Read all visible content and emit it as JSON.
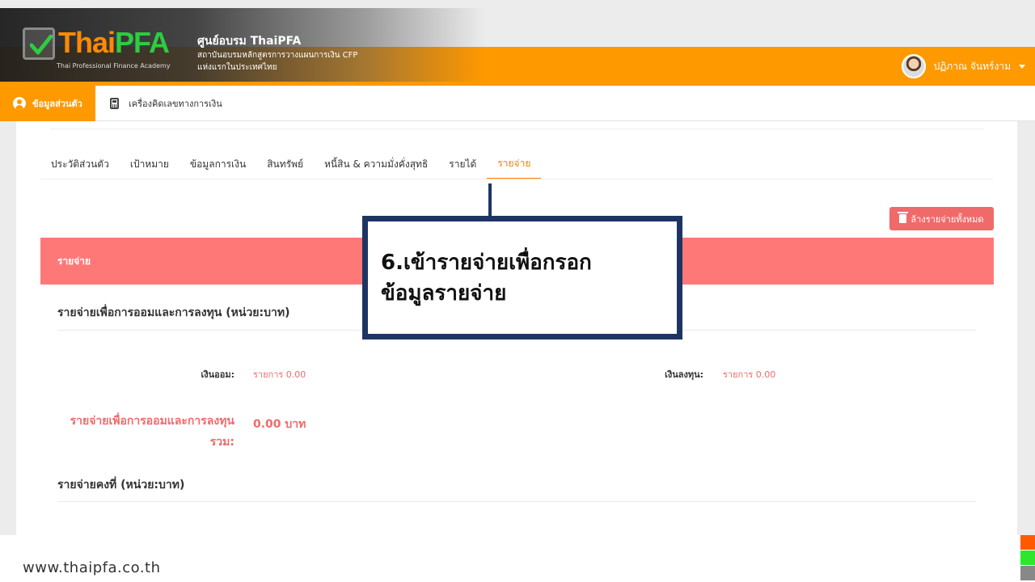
{
  "header": {
    "logo_thai": "Thai",
    "logo_pfa": "PFA",
    "logo_subtitle": "Thai Professional Finance Academy",
    "title": "ศูนย์อบรม ThaiPFA",
    "line1": "สถาบันอบรมหลักสูตรการวางแผนการเงิน CFP",
    "line2": "แห่งแรกในประเทศไทย"
  },
  "user": {
    "name": "ปฏิภาณ จันทร์งาม"
  },
  "nav": {
    "profile_label": "ข้อมูลส่วนตัว",
    "calculator_label": "เครื่องคิดเลขทางการเงิน"
  },
  "tabs": [
    {
      "label": "ประวัติส่วนตัว",
      "active": false
    },
    {
      "label": "เป้าหมาย",
      "active": false
    },
    {
      "label": "ข้อมูลการเงิน",
      "active": false
    },
    {
      "label": "สินทรัพย์",
      "active": false
    },
    {
      "label": "หนี้สิน & ความมั่งคั่งสุทธิ",
      "active": false
    },
    {
      "label": "รายได้",
      "active": false
    },
    {
      "label": "รายจ่าย",
      "active": true
    }
  ],
  "clear_button": "ล้างรายจ่ายทั้งหมด",
  "section": {
    "title": "รายจ่าย",
    "savings_heading": "รายจ่ายเพื่อการออมและการลงทุน (หน่วย:บาท)",
    "savings_label": "เงินออม:",
    "savings_value": "รายการ 0.00",
    "invest_label": "เงินลงทุน:",
    "invest_value": "รายการ 0.00",
    "total_label": "รายจ่ายเพื่อการออมและการลงทุนรวม:",
    "total_value": "0.00 บาท",
    "fixed_heading": "รายจ่ายคงที่ (หน่วย:บาท)"
  },
  "callout": {
    "line1": "6.เข้ารายจ่ายเพื่อกรอก",
    "line2": "ข้อมูลรายจ่าย"
  },
  "footer": {
    "url": "www.thaipfa.co.th"
  },
  "colors": {
    "orange": "#ff9900",
    "salmon": "#ff7878",
    "navy": "#1e3564",
    "green": "#2ecc40"
  }
}
